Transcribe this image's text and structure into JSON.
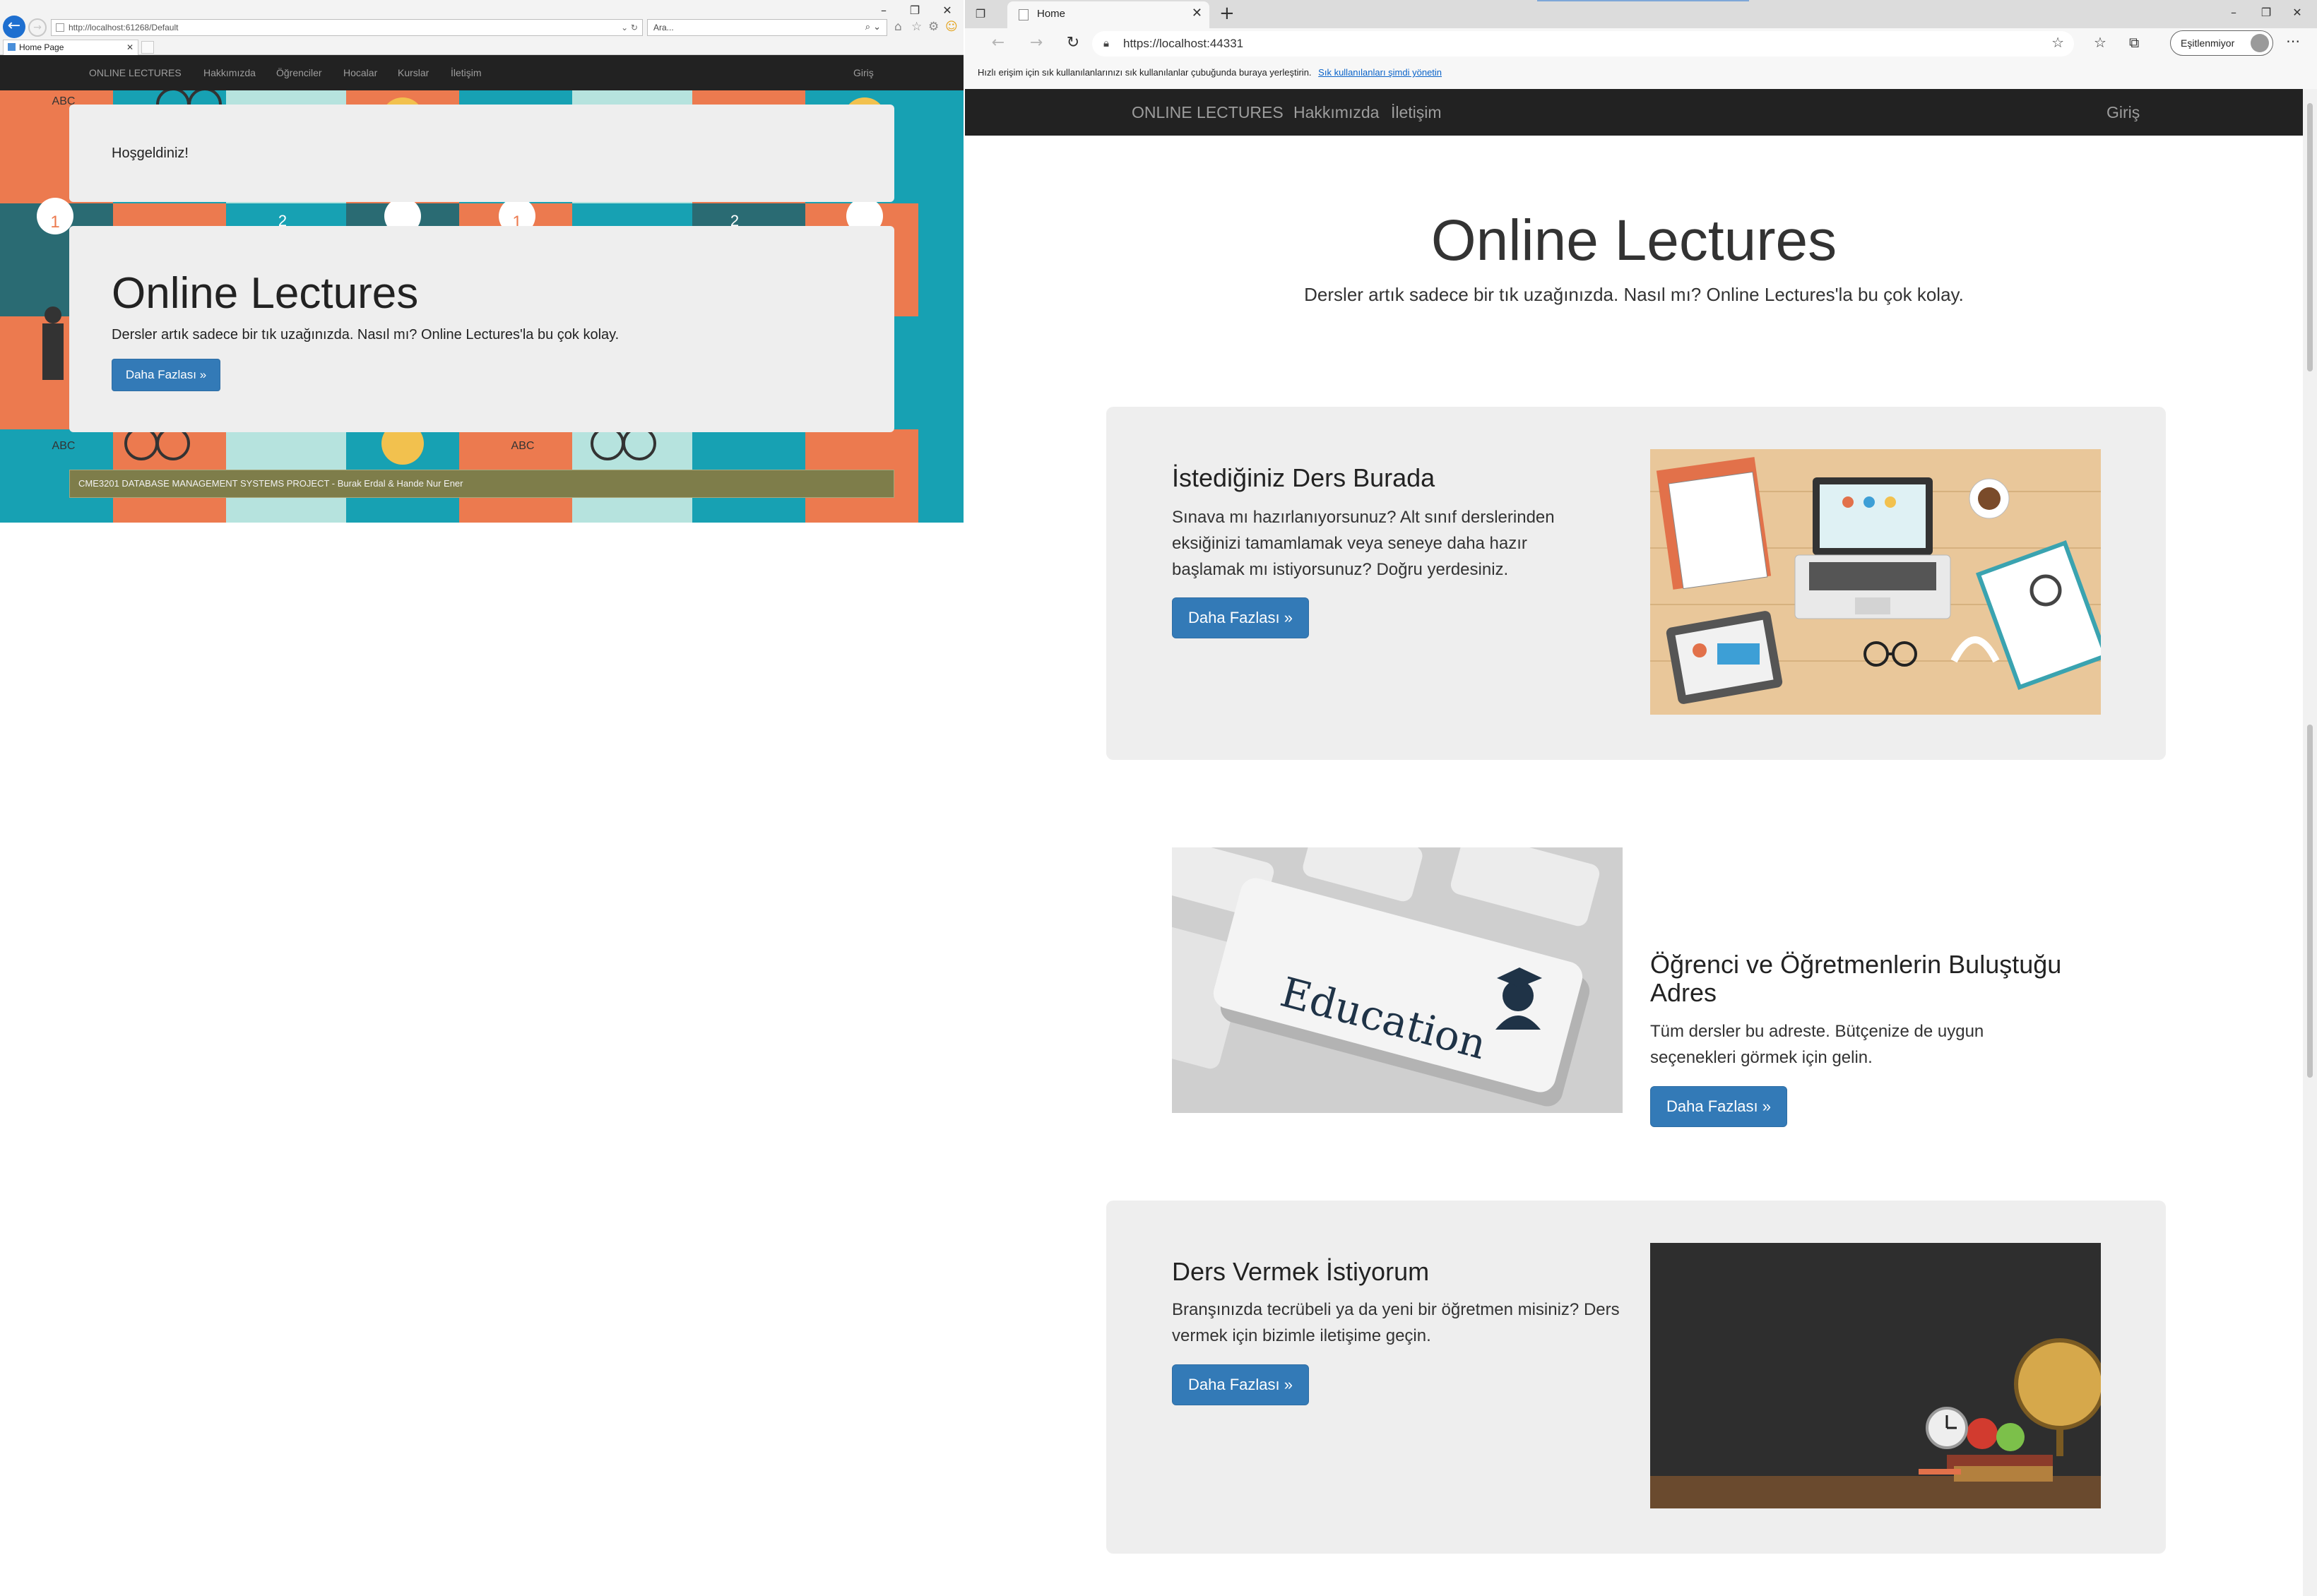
{
  "left_window": {
    "window_controls": {
      "minimize": "–",
      "restore": "❐",
      "close": "✕"
    },
    "address": {
      "url": "http://localhost:61268/Default",
      "controls": "⌄ ↻"
    },
    "search": {
      "placeholder": "Ara...",
      "icon": "⌕ ⌄"
    },
    "tab": {
      "title": "Home Page",
      "close": "✕"
    },
    "nav": {
      "brand": "ONLINE LECTURES",
      "items": [
        "Hakkımızda",
        "Öğrenciler",
        "Hocalar",
        "Kurslar",
        "İletişim"
      ],
      "login": "Giriş"
    },
    "welcome": "Hoşgeldiniz!",
    "jumbotron": {
      "title": "Online Lectures",
      "text": "Dersler artık sadece bir tık uzağınızda. Nasıl mı? Online Lectures'la bu çok kolay.",
      "button": "Daha Fazlası »"
    },
    "footer": "CME3201 DATABASE MANAGEMENT SYSTEMS PROJECT - Burak Erdal & Hande Nur Ener",
    "pattern_labels": {
      "abc": "ABC",
      "one": "1",
      "two": "2"
    }
  },
  "right_window": {
    "window_controls": {
      "minimize": "–",
      "restore": "❐",
      "close": "✕"
    },
    "tab": {
      "title": "Home",
      "close": "✕",
      "new": "+"
    },
    "address": {
      "url": "https://localhost:44331"
    },
    "profile": "Eşitlenmiyor",
    "favorites_bar": {
      "text": "Hızlı erişim için sık kullanılanlarınızı sık kullanılanlar çubuğunda buraya yerleştirin.",
      "link": "Sık kullanılanları şimdi yönetin"
    },
    "nav": {
      "brand": "ONLINE LECTURES",
      "items": [
        "Hakkımızda",
        "İletişim"
      ],
      "login": "Giriş"
    },
    "hero": {
      "title": "Online Lectures",
      "text": "Dersler artık sadece bir tık uzağınızda. Nasıl mı? Online Lectures'la bu çok kolay."
    },
    "features": [
      {
        "title": "İstediğiniz Ders Burada",
        "text": "Sınava mı hazırlanıyorsunuz? Alt sınıf derslerinden eksiğinizi tamamlamak veya seneye daha hazır başlamak mı istiyorsunuz? Doğru yerdesiniz.",
        "button": "Daha Fazlası »"
      },
      {
        "title": "Öğrenci ve Öğretmenlerin Buluştuğu Adres",
        "text": "Tüm dersler bu adreste. Bütçenize de uygun seçenekleri görmek için gelin.",
        "button": "Daha Fazlası »"
      },
      {
        "title": "Ders Vermek İstiyorum",
        "text": "Branşınızda tecrübeli ya da yeni bir öğretmen misiniz? Ders vermek için bizimle iletişime geçin.",
        "button": "Daha Fazlası »"
      }
    ],
    "images": {
      "keyboard_key": "Education"
    }
  },
  "colors": {
    "navbar": "#222222",
    "nav_text": "#9d9d9d",
    "button": "#337ab7",
    "card": "#eeeeee",
    "pattern_teal": "#17a1b3",
    "pattern_orange": "#ec7a4f",
    "footer_olive": "#7e7d4a"
  },
  "icons": [
    "back-icon",
    "forward-icon",
    "refresh-icon",
    "lock-icon",
    "star-icon",
    "home-icon",
    "gear-icon",
    "smiley-icon",
    "tab-actions-icon",
    "favorites-icon",
    "collections-icon",
    "more-icon",
    "graduation-cap-icon"
  ]
}
